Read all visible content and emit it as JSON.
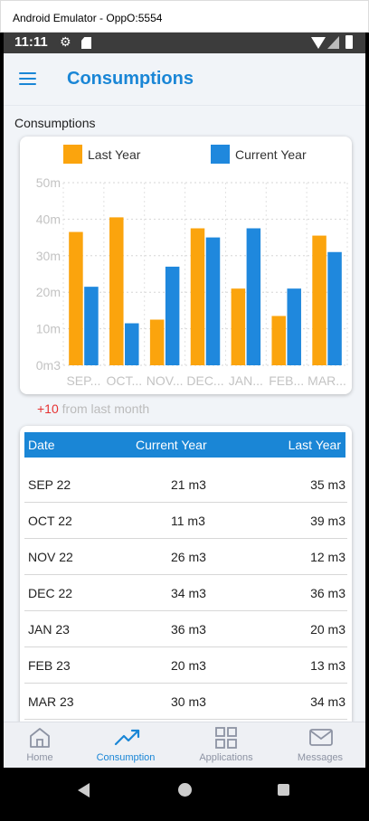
{
  "window": {
    "title": "Android Emulator - OppO:5554"
  },
  "statusbar": {
    "time": "11:11"
  },
  "appbar": {
    "title": "Consumptions"
  },
  "section": {
    "title": "Consumptions"
  },
  "colors": {
    "last_year": "#FBA40D",
    "current_year": "#1F88DD",
    "accent": "#1A86D6",
    "delta_positive": "#E63232"
  },
  "chart_data": {
    "type": "bar",
    "categories": [
      "SEP...",
      "OCT...",
      "NOV...",
      "DEC...",
      "JAN...",
      "FEB...",
      "MAR..."
    ],
    "series": [
      {
        "name": "Last Year",
        "values": [
          36.5,
          40.5,
          12.5,
          37.5,
          21,
          13.5,
          35.5
        ]
      },
      {
        "name": "Current Year",
        "values": [
          21.5,
          11.5,
          27,
          35,
          37.5,
          21,
          31
        ]
      }
    ],
    "y_ticks": [
      "0m3",
      "10m",
      "20m",
      "30m",
      "40m",
      "50m"
    ],
    "ylim": [
      0,
      50
    ],
    "grid": true,
    "legend": "top"
  },
  "delta": {
    "value": "+10",
    "text": " from last month"
  },
  "table": {
    "headers": [
      "Date",
      "Current Year",
      "Last Year"
    ],
    "rows": [
      [
        "SEP 22",
        "21 m3",
        "35 m3"
      ],
      [
        "OCT 22",
        "11 m3",
        "39 m3"
      ],
      [
        "NOV 22",
        "26 m3",
        "12 m3"
      ],
      [
        "DEC 22",
        "34 m3",
        "36 m3"
      ],
      [
        "JAN 23",
        "36 m3",
        "20 m3"
      ],
      [
        "FEB 23",
        "20 m3",
        "13 m3"
      ],
      [
        "MAR 23",
        "30 m3",
        "34 m3"
      ]
    ]
  },
  "bottomnav": {
    "items": [
      {
        "label": "Home",
        "icon": "home-icon",
        "active": false
      },
      {
        "label": "Consumption",
        "icon": "trending-up-icon",
        "active": true
      },
      {
        "label": "Applications",
        "icon": "apps-grid-icon",
        "active": false
      },
      {
        "label": "Messages",
        "icon": "mail-icon",
        "active": false
      }
    ]
  }
}
